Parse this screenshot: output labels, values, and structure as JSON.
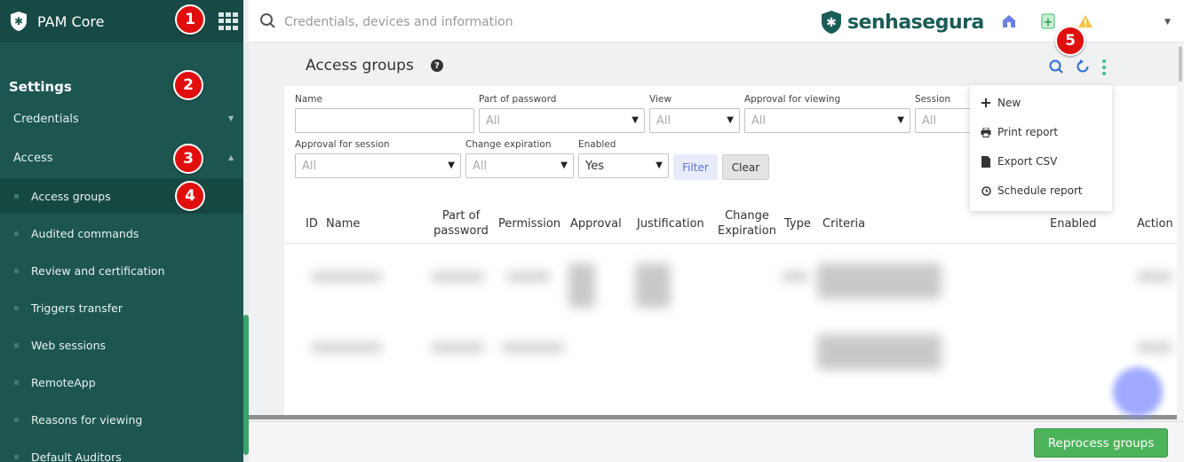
{
  "app": {
    "name": "PAM Core",
    "logo_text": "senhasegura"
  },
  "search": {
    "placeholder": "Credentials, devices and information"
  },
  "sidebar": {
    "section_title": "Settings",
    "groups": [
      {
        "label": "Credentials",
        "expanded": false
      },
      {
        "label": "Access",
        "expanded": true
      }
    ],
    "items": [
      {
        "label": "Access groups",
        "active": true
      },
      {
        "label": "Audited commands"
      },
      {
        "label": "Review and certification"
      },
      {
        "label": "Triggers transfer"
      },
      {
        "label": "Web sessions"
      },
      {
        "label": "RemoteApp"
      },
      {
        "label": "Reasons for viewing"
      },
      {
        "label": "Default Auditors"
      }
    ]
  },
  "page": {
    "title": "Access groups",
    "help_icon": "question-circle-icon"
  },
  "filters": {
    "name": {
      "label": "Name",
      "value": ""
    },
    "part_of_password": {
      "label": "Part of password",
      "value": "All"
    },
    "view": {
      "label": "View",
      "value": "All"
    },
    "approval_for_viewing": {
      "label": "Approval for viewing",
      "value": "All"
    },
    "session": {
      "label": "Session",
      "value": "All"
    },
    "approval_for_session": {
      "label": "Approval for session",
      "value": "All"
    },
    "change_expiration": {
      "label": "Change expiration",
      "value": "All"
    },
    "enabled": {
      "label": "Enabled",
      "value": "Yes"
    },
    "filter_button": "Filter",
    "clear_button": "Clear"
  },
  "table": {
    "columns": {
      "id": "ID",
      "name": "Name",
      "part_of_password_1": "Part of",
      "part_of_password_2": "password",
      "permission": "Permission",
      "approval": "Approval",
      "justification": "Justification",
      "change_expiration_1": "Change",
      "change_expiration_2": "Expiration",
      "type": "Type",
      "criteria": "Criteria",
      "enabled": "Enabled",
      "action": "Action"
    }
  },
  "menu": {
    "items": [
      {
        "label": "New",
        "icon": "plus-icon"
      },
      {
        "label": "Print report",
        "icon": "printer-icon"
      },
      {
        "label": "Export CSV",
        "icon": "file-icon"
      },
      {
        "label": "Schedule report",
        "icon": "clock-icon"
      }
    ]
  },
  "footer": {
    "reprocess_button": "Reprocess groups"
  },
  "badges": [
    "1",
    "2",
    "3",
    "4",
    "5"
  ],
  "colors": {
    "sidebar_bg": "#1d5651",
    "accent_green": "#4cb35b",
    "badge_red": "#e10e0e",
    "link_blue": "#2d6fd6"
  }
}
